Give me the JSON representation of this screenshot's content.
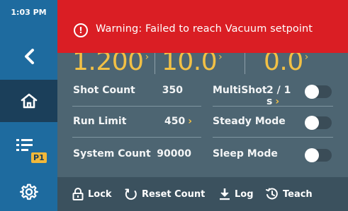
{
  "status": {
    "time": "1:03 PM"
  },
  "sidebar": {
    "program_badge": "P1"
  },
  "warning": {
    "message": "Warning: Failed to reach Vacuum setpoint"
  },
  "setpoints": [
    {
      "value": "1.200"
    },
    {
      "value": "10.0"
    },
    {
      "value": "0.0"
    }
  ],
  "rows": {
    "shot_count": {
      "label": "Shot Count",
      "value": "350"
    },
    "multishot": {
      "label": "MultiShot",
      "value": "2 / 1 s",
      "enabled": false
    },
    "run_limit": {
      "label": "Run Limit",
      "value": "450"
    },
    "steady_mode": {
      "label": "Steady Mode",
      "enabled": false
    },
    "system_count": {
      "label": "System Count",
      "value": "90000"
    },
    "sleep_mode": {
      "label": "Sleep Mode",
      "enabled": false
    }
  },
  "bottombar": {
    "lock": "Lock",
    "reset_count": "Reset Count",
    "log": "Log",
    "teach": "Teach"
  },
  "colors": {
    "sidebar": "#1e6b9f",
    "sidebar_active": "#1b3f5a",
    "warning": "#da1e24",
    "accent": "#f2c045",
    "background": "#4d6572",
    "bottombar": "#3b515e"
  },
  "icons": [
    "back-chevron-icon",
    "home-icon",
    "program-list-icon",
    "gear-icon",
    "lock-icon",
    "reset-icon",
    "download-icon",
    "teach-icon",
    "exclamation-icon"
  ]
}
